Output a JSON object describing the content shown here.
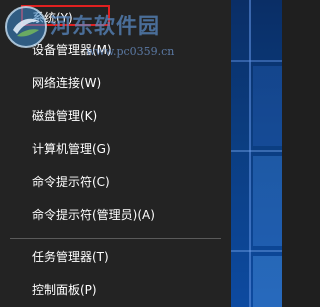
{
  "menu": {
    "items": [
      {
        "label": "系统(Y)"
      },
      {
        "label": "设备管理器(M)"
      },
      {
        "label": "网络连接(W)"
      },
      {
        "label": "磁盘管理(K)"
      },
      {
        "label": "计算机管理(G)"
      },
      {
        "label": "命令提示符(C)"
      },
      {
        "label": "命令提示符(管理员)(A)"
      },
      {
        "label": "任务管理器(T)"
      },
      {
        "label": "控制面板(P)"
      }
    ],
    "highlighted_item": "系统(Y)",
    "highlight_color": "#e02020"
  },
  "watermark": {
    "title": "河东软件园",
    "url": "www.pc0359.cn"
  },
  "colors": {
    "menu_background": "#232323",
    "menu_text": "#ffffff",
    "separator": "#5a5a5a",
    "desktop_accent": "#0b3d80"
  }
}
